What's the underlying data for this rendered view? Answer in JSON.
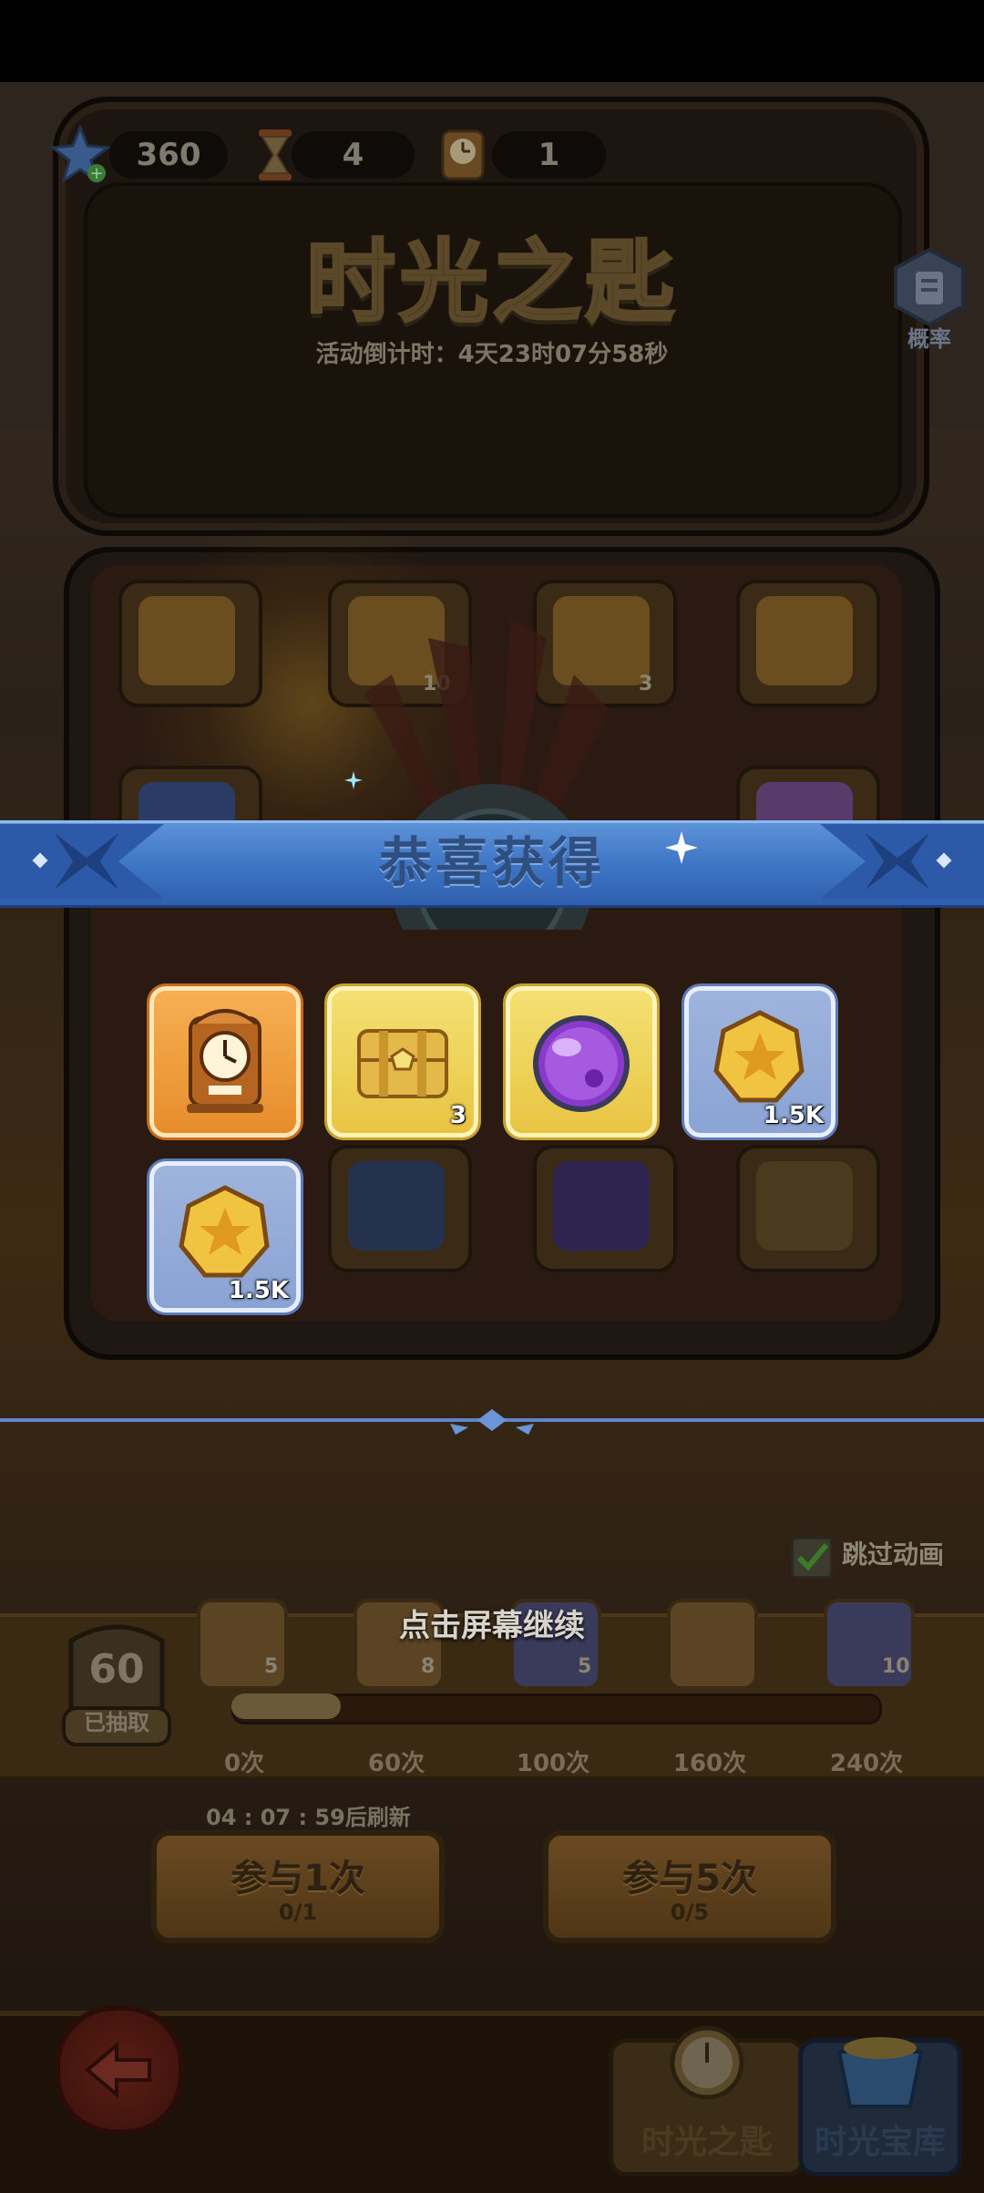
{
  "resources": [
    {
      "icon": "star-gem-icon",
      "value": "360"
    },
    {
      "icon": "hourglass-icon",
      "value": "4"
    },
    {
      "icon": "clock-icon",
      "value": "1"
    }
  ],
  "title": "时光之匙",
  "countdown": "活动倒计时：4天23时07分58秒",
  "probability_label": "概率",
  "board_slots": [
    {
      "icon": "clock-icon",
      "qty": ""
    },
    {
      "icon": "key-icon",
      "qty": "10"
    },
    {
      "icon": "chest-icon",
      "qty": "3"
    },
    {
      "icon": "hourglass-icon",
      "qty": ""
    }
  ],
  "banner_title": "恭喜获得",
  "rewards": [
    {
      "icon": "clock-icon",
      "qty": "",
      "style": "orange"
    },
    {
      "icon": "chest-icon",
      "qty": "3",
      "style": "gold"
    },
    {
      "icon": "purple-orb-icon",
      "qty": "",
      "style": "gold"
    },
    {
      "icon": "star-coin-icon",
      "qty": "1.5K",
      "style": "blue"
    },
    {
      "icon": "star-coin-icon",
      "qty": "1.5K",
      "style": "blue"
    }
  ],
  "skip_animation": {
    "label": "跳过动画",
    "checked": true
  },
  "tap_continue": "点击屏幕继续",
  "progress": {
    "count": "60",
    "count_label": "已抽取",
    "fill_fraction": 0.17,
    "milestones": [
      {
        "label": "0次",
        "qty": "5"
      },
      {
        "label": "60次",
        "qty": "8"
      },
      {
        "label": "100次",
        "qty": "5"
      },
      {
        "label": "160次",
        "qty": ""
      },
      {
        "label": "240次",
        "qty": "10"
      }
    ]
  },
  "refresh_text": "04 : 07 : 59后刷新",
  "buttons": [
    {
      "label": "参与1次",
      "sub": "0/1"
    },
    {
      "label": "参与5次",
      "sub": "0/5"
    }
  ],
  "nav": {
    "back_icon": "back-arrow-icon",
    "tab1": "时光之匙",
    "tab2": "时光宝库"
  },
  "colors": {
    "banner": "#3f76c6",
    "gold": "#e8c442",
    "orange": "#e78c2c",
    "blue": "#8aa3d3"
  }
}
